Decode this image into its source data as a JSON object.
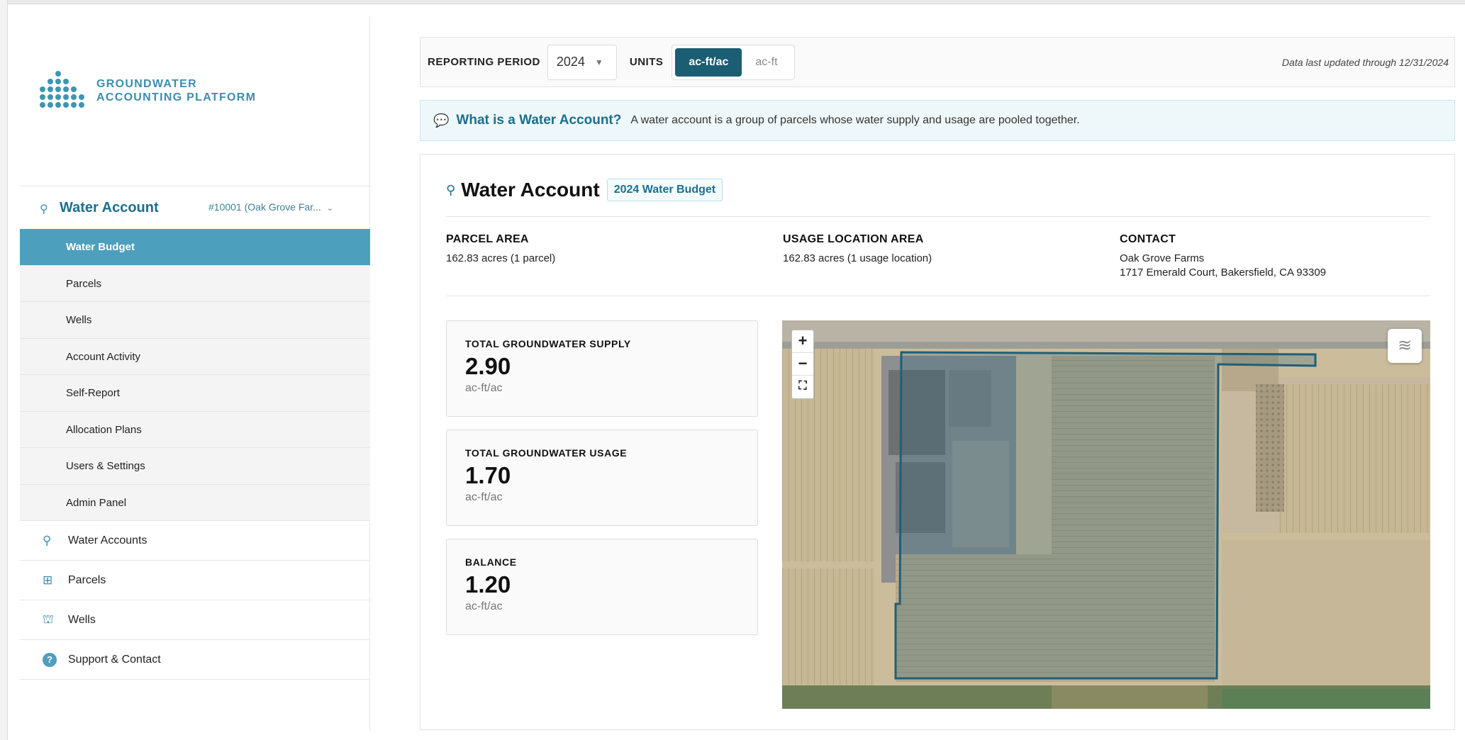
{
  "logo": {
    "line1": "GROUNDWATER",
    "line2": "ACCOUNTING PLATFORM"
  },
  "sidebar": {
    "account_title": "Water Account",
    "account_selector": "#10001 (Oak Grove Far...",
    "subnav": [
      {
        "label": "Water Budget",
        "active": true
      },
      {
        "label": "Parcels"
      },
      {
        "label": "Wells"
      },
      {
        "label": "Account Activity"
      },
      {
        "label": "Self-Report"
      },
      {
        "label": "Allocation Plans"
      },
      {
        "label": "Users & Settings"
      },
      {
        "label": "Admin Panel"
      }
    ],
    "mainnav": [
      {
        "label": "Water Accounts",
        "icon": "water-account-icon"
      },
      {
        "label": "Parcels",
        "icon": "grid-icon"
      },
      {
        "label": "Wells",
        "icon": "well-icon"
      },
      {
        "label": "Support & Contact",
        "icon": "help-icon"
      }
    ]
  },
  "toolbar": {
    "reporting_period_label": "REPORTING PERIOD",
    "year": "2024",
    "units_label": "UNITS",
    "unit_options": [
      "ac-ft/ac",
      "ac-ft"
    ],
    "unit_selected": "ac-ft/ac",
    "updated": "Data last updated through 12/31/2024"
  },
  "info": {
    "question": "What is a Water Account?",
    "description": "A water account is a group of parcels whose water supply and usage are pooled together."
  },
  "card": {
    "title": "Water Account",
    "badge": "2024 Water Budget",
    "parcel_area": {
      "label": "PARCEL AREA",
      "value": "162.83 acres (1 parcel)"
    },
    "usage_area": {
      "label": "USAGE LOCATION AREA",
      "value": "162.83 acres (1 usage location)"
    },
    "contact": {
      "label": "CONTACT",
      "name": "Oak Grove Farms",
      "address": "1717 Emerald Court, Bakersfield, CA 93309"
    },
    "stats": [
      {
        "label": "TOTAL GROUNDWATER SUPPLY",
        "value": "2.90",
        "unit": "ac-ft/ac"
      },
      {
        "label": "TOTAL GROUNDWATER USAGE",
        "value": "1.70",
        "unit": "ac-ft/ac"
      },
      {
        "label": "BALANCE",
        "value": "1.20",
        "unit": "ac-ft/ac"
      }
    ]
  },
  "map": {
    "zoom_in": "+",
    "zoom_out": "−",
    "fullscreen": "⛶",
    "boundary_color": "#1f5f78"
  }
}
